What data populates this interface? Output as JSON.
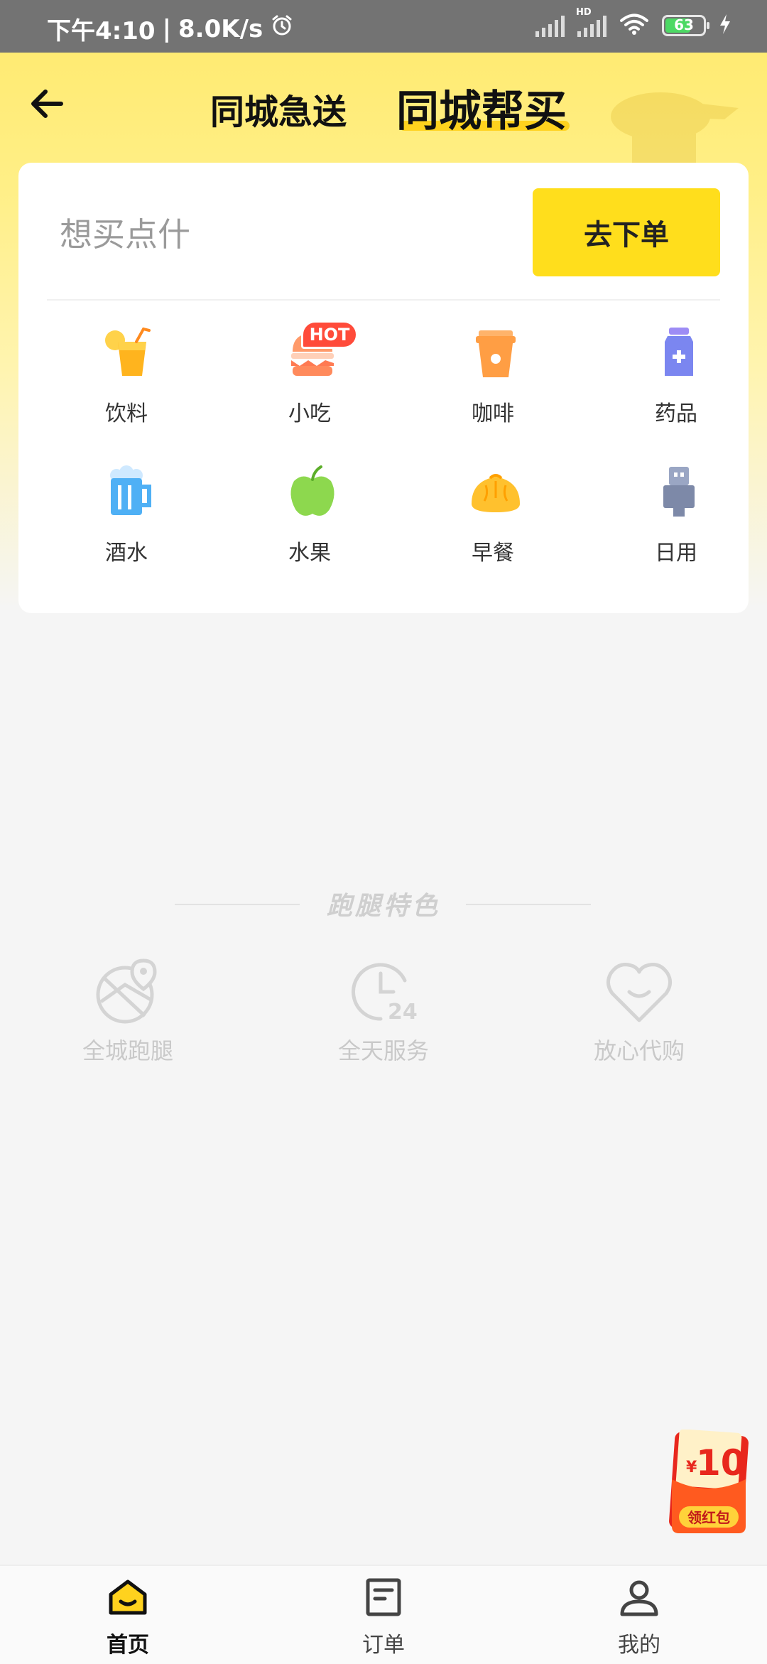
{
  "status_bar": {
    "time": "下午4:10",
    "network_speed": "8.0K/s",
    "network_type": "HD",
    "battery_level": "63",
    "colors": {
      "background": "#737373",
      "battery_fill": "#4cd964"
    }
  },
  "header": {
    "tab_send": "同城急送",
    "tab_buy": "同城帮买",
    "active_tab": "tab_buy",
    "accent_color": "#ffd21e"
  },
  "search": {
    "placeholder": "想买点什",
    "value": "",
    "submit_label": "去下单"
  },
  "categories": {
    "items": [
      {
        "label": "饮料",
        "icon": "drink-icon"
      },
      {
        "label": "小吃",
        "icon": "burger-icon",
        "badge": "HOT"
      },
      {
        "label": "咖啡",
        "icon": "coffee-icon"
      },
      {
        "label": "药品",
        "icon": "medicine-icon"
      },
      {
        "label": "酒水",
        "icon": "beer-icon"
      },
      {
        "label": "水果",
        "icon": "apple-icon"
      },
      {
        "label": "早餐",
        "icon": "bun-icon"
      },
      {
        "label": "日用",
        "icon": "daily-goods-icon"
      }
    ]
  },
  "features": {
    "title": "跑腿特色",
    "items": [
      {
        "label": "全城跑腿",
        "icon": "map-pin-icon"
      },
      {
        "label": "全天服务",
        "icon": "clock-24-icon",
        "icon_text": "24"
      },
      {
        "label": "放心代购",
        "icon": "heart-smile-icon"
      }
    ]
  },
  "promo": {
    "currency": "¥",
    "amount": "10",
    "label": "领红包",
    "color": "#e8271d"
  },
  "bottom_nav": {
    "items": [
      {
        "label": "首页",
        "icon": "home-icon",
        "active": true
      },
      {
        "label": "订单",
        "icon": "order-icon",
        "active": false
      },
      {
        "label": "我的",
        "icon": "profile-icon",
        "active": false
      }
    ]
  }
}
